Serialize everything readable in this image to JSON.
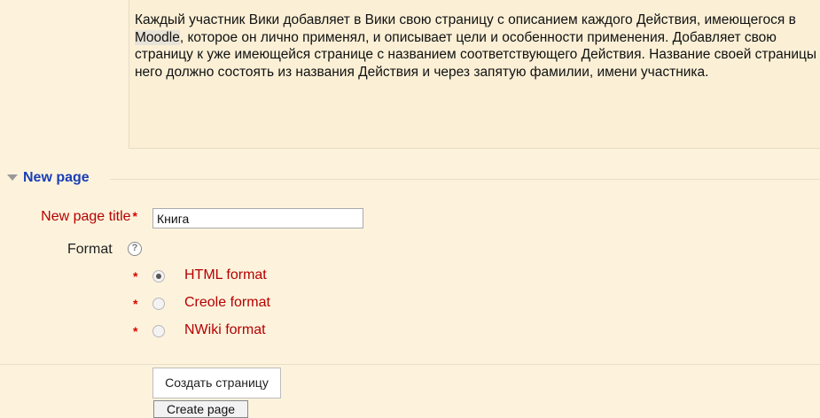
{
  "description": {
    "part1": "Каждый участник Вики добавляет в Вики свою страницу  с описанием каждого Действия, имеющегося в ",
    "moodle_link": "Moodle",
    "part2": ", которое он лично применял, и описывает цели и особенности применения. Добавляет свою страницу к уже имеющейся странице с названием соответствующего Действия. Название своей страницы у него должно состоять из названия Действия и через запятую фамилии, имени участника."
  },
  "section": {
    "title": "New page"
  },
  "form": {
    "title_label": "New page title",
    "required_marker": "*",
    "title_value": "Книга",
    "format_label": "Format",
    "help_icon_glyph": "?",
    "formats": [
      {
        "label": "HTML format",
        "checked": true
      },
      {
        "label": "Creole format",
        "checked": false
      },
      {
        "label": "NWiki format",
        "checked": false
      }
    ]
  },
  "buttons": {
    "create_ru": "Создать страницу",
    "create_en": "Create page"
  },
  "colors": {
    "background": "#fdf3dd",
    "section_title": "#1a3fb5",
    "label_red": "#b50000",
    "required_star": "#dd0000"
  },
  "icons": {
    "section_toggle": "collapse-triangle-icon",
    "help": "help-icon"
  }
}
